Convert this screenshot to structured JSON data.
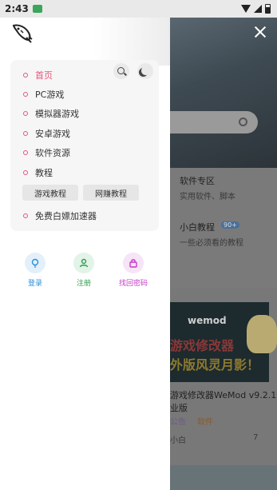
{
  "status_bar": {
    "time": "2:43"
  },
  "menu": {
    "items": [
      {
        "label": "首页"
      },
      {
        "label": "PC游戏"
      },
      {
        "label": "模拟器游戏"
      },
      {
        "label": "安卓游戏"
      },
      {
        "label": "软件资源"
      },
      {
        "label": "教程"
      },
      {
        "label": "免费白嫖加速器"
      }
    ],
    "sub_items": [
      {
        "label": "游戏教程"
      },
      {
        "label": "网赚教程"
      }
    ]
  },
  "actions": [
    {
      "label": "登录",
      "color": "#2b8fd9",
      "bg": "#e3f0fb"
    },
    {
      "label": "注册",
      "color": "#2f9e4a",
      "bg": "#e2f3e7"
    },
    {
      "label": "找回密码",
      "color": "#c43ac7",
      "bg": "#f6e4f7"
    }
  ],
  "background": {
    "card1_title": "软件专区",
    "card1_sub": "实用软件、脚本",
    "card2_title": "小白教程",
    "card2_badge": "90+",
    "card2_sub": "一些必须看的教程",
    "banner_brand": "wemod",
    "banner_line1": "游戏修改器",
    "banner_line2": "外版风灵月影！",
    "post_title1": "游戏修改器WeMod v9.2.1",
    "post_title2": "业版",
    "post_tag1": "公告",
    "post_tag2": "软件",
    "post_author": "小白",
    "post_count": "7"
  },
  "colors": {
    "accent": "#e8527a"
  }
}
